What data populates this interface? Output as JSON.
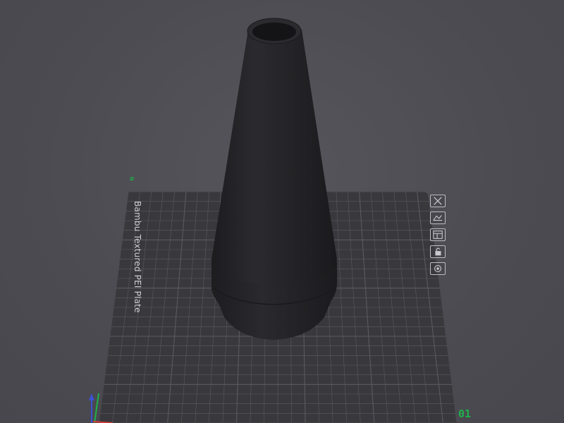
{
  "viewport": {
    "background_color": "#4c4c52"
  },
  "plate": {
    "name": "Bambu Textured PEI Plate",
    "number": "01",
    "surface_color": "#38383d",
    "grid_color": "#5a5a60",
    "accent_color": "#1fb24a"
  },
  "model": {
    "shape": "tapered-nozzle-cone",
    "color": "#232326"
  },
  "plate_toolbar": [
    {
      "icon": "close-icon",
      "label": "Remove plate"
    },
    {
      "icon": "auto-orient-icon",
      "label": "Auto orient"
    },
    {
      "icon": "arrange-icon",
      "label": "Arrange"
    },
    {
      "icon": "lock-icon",
      "label": "Lock plate"
    },
    {
      "icon": "plate-settings-icon",
      "label": "Plate settings"
    }
  ],
  "axes": {
    "x_color": "#d23b3b",
    "y_color": "#1fb24a",
    "z_color": "#3b52d2"
  }
}
